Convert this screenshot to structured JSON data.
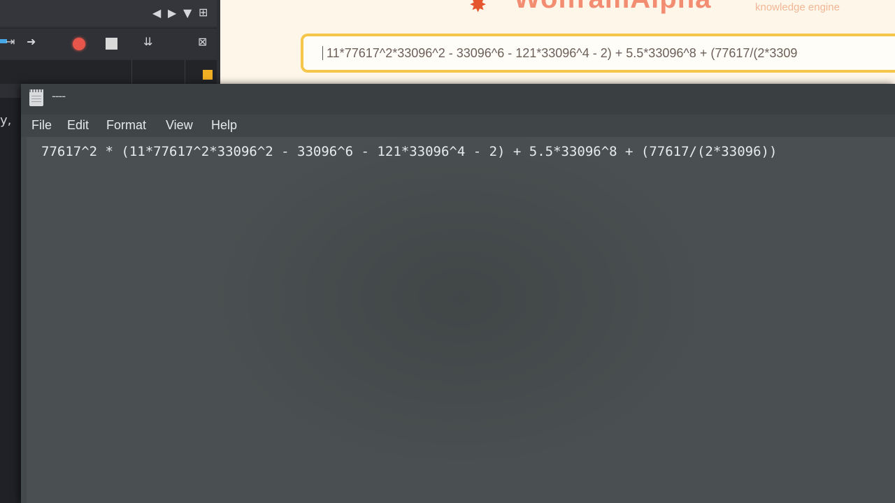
{
  "background_app": {
    "left_fragment": "y,",
    "controls": [
      "◀",
      "▶",
      "▼",
      "⊞",
      "⇥",
      "➜",
      "record",
      "stop",
      "⇊",
      "⊠"
    ]
  },
  "wolfram": {
    "logo": "WolframAlpha",
    "tagline": "knowledge engine",
    "query": "11*77617^2*33096^2 - 33096^6 - 121*33096^4 - 2) + 5.5*33096^8 + (77617/(2*3309",
    "brand_color": "#f06a4a",
    "search_border_color": "#f5c64a"
  },
  "notepad": {
    "title": "----",
    "menu": [
      "File",
      "Edit",
      "Format",
      "View",
      "Help"
    ],
    "content": "77617^2 * (11*77617^2*33096^2 - 33096^6 - 121*33096^4 - 2) + 5.5*33096^8 + (77617/(2*33096))",
    "icon": "notepad-icon"
  }
}
